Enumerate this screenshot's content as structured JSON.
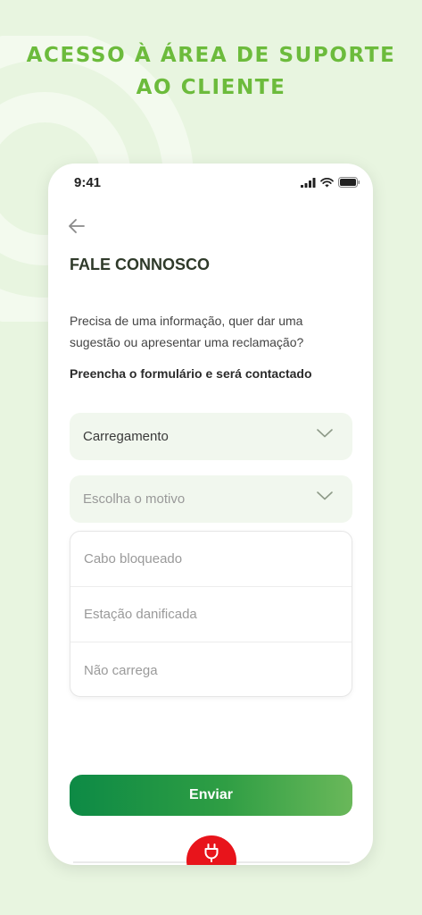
{
  "headline": {
    "line1": "ACESSO À ÁREA DE SUPORTE",
    "line2": "AO CLIENTE"
  },
  "status_bar": {
    "time": "9:41",
    "icons": [
      "signal-icon",
      "wifi-icon",
      "battery-icon"
    ]
  },
  "screen": {
    "back_icon": "arrow-left-icon",
    "title": "FALE CONNOSCO",
    "description": "Precisa de uma informação, quer dar uma sugestão ou apresentar uma reclamação?",
    "instruction": "Preencha o formulário e será contactado"
  },
  "form": {
    "category_select": {
      "value": "Carregamento",
      "icon": "chevron-down-icon"
    },
    "reason_select": {
      "placeholder": "Escolha o motivo",
      "icon": "chevron-down-icon"
    },
    "reason_options": [
      "Cabo bloqueado",
      "Estação danificada",
      "Não carrega"
    ],
    "submit_label": "Enviar"
  },
  "tab_bar": {
    "center_icon": "plug-icon"
  },
  "colors": {
    "accent_green": "#6cbb3c",
    "button_gradient_start": "#0d8a45",
    "button_gradient_end": "#6ab85a",
    "plug_red": "#e8141b",
    "page_background": "#e8f5e0",
    "select_background": "#f1f7ee"
  }
}
